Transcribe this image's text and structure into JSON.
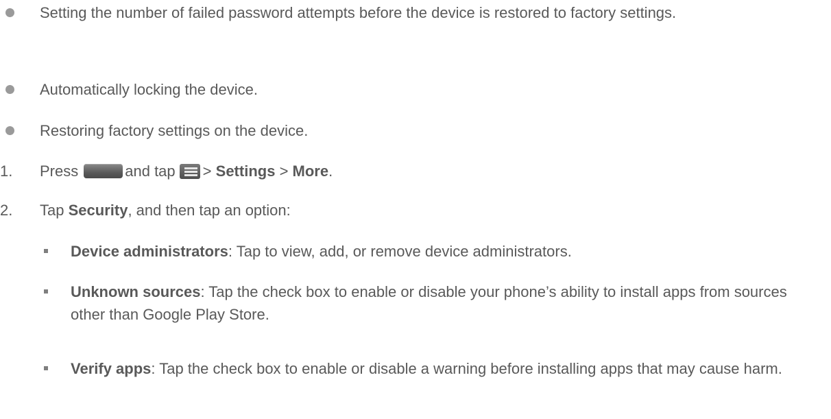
{
  "bullets": [
    "Setting the number of failed password attempts before the device is restored to factory settings.",
    "Automatically locking the device.",
    "Restoring factory settings on the device."
  ],
  "step1": {
    "number": "1.",
    "press": "Press",
    "and_tap": "and tap",
    "sep1": ">",
    "settings": "Settings",
    "sep2": ">",
    "more": "More",
    "end": ".",
    "home_key_icon": "home-key-icon",
    "menu_key_icon": "menu-key-icon"
  },
  "step2": {
    "number": "2.",
    "tap": "Tap",
    "security": "Security",
    "rest": ", and then tap an option:"
  },
  "options": [
    {
      "title": "Device administrators",
      "desc": ": Tap to view, add, or remove device administrators."
    },
    {
      "title": "Unknown sources",
      "desc": ": Tap the check box to enable or disable your phone’s ability to install apps from sources other than Google Play Store."
    },
    {
      "title": "Verify apps",
      "desc": ": Tap the check box to enable or disable a warning before installing apps that may cause harm."
    }
  ]
}
